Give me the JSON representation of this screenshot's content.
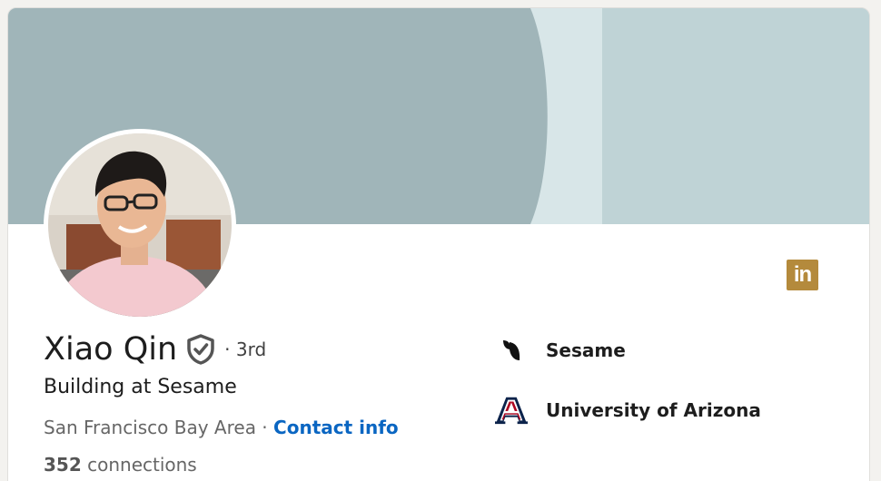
{
  "profile": {
    "name": "Xiao Qin",
    "degree": "· 3rd",
    "headline": "Building at Sesame",
    "location": "San Francisco Bay Area",
    "separator": " · ",
    "contact_info": "Contact info",
    "connections_count": "352",
    "connections_label": " connections"
  },
  "organizations": [
    {
      "name": "Sesame",
      "icon": "sesame-logo-icon"
    },
    {
      "name": "University of Arizona",
      "icon": "university-of-arizona-logo-icon"
    }
  ],
  "badges": {
    "linkedin_text": "in",
    "linkedin_color": "#b48a3c"
  },
  "colors": {
    "banner_light": "#bfd3d6",
    "banner_mid": "#d6e4e6",
    "banner_dark": "#a0b5b9",
    "link": "#0a66c2"
  }
}
